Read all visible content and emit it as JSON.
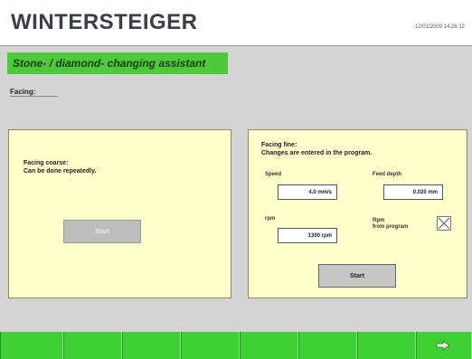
{
  "header": {
    "logo_text": "WINTERSTEIGER",
    "datetime": "12/01/2009 14:26:12"
  },
  "title": "Stone- / diamond- changing assistant",
  "section_label": "Facing:",
  "coarse": {
    "line1": "Facing coarse:",
    "line2": "Can be done repeatedly.",
    "start_label": "Start"
  },
  "fine": {
    "line1": "Facing fine:",
    "line2": "Changes are entered in the program.",
    "speed_label": "Speed",
    "speed_value": "4.0  mm/s",
    "feed_label": "Feed depth",
    "feed_value": "0.020  mm",
    "rpm_label": "rpm",
    "rpm_value": "1300  rpm",
    "rpm_from_label_1": "Rpm",
    "rpm_from_label_2": "from program",
    "rpm_from_checked": true,
    "start_label": "Start"
  },
  "footer": {
    "next_icon": "arrow-right-icon",
    "color": "#3fd035"
  },
  "colors": {
    "accent": "#4ec93b",
    "panel": "#ffffcc",
    "background": "#d4d4d4"
  }
}
